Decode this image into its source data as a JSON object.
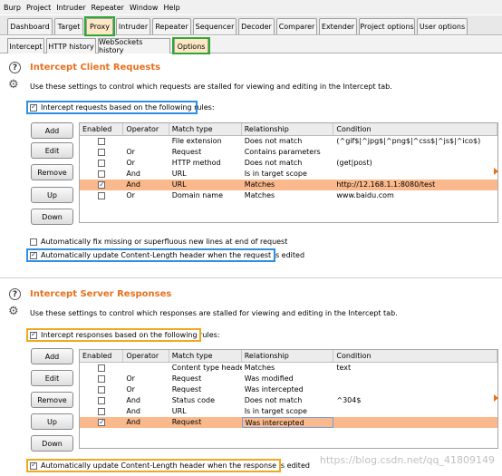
{
  "menu": [
    "Burp",
    "Project",
    "Intruder",
    "Repeater",
    "Window",
    "Help"
  ],
  "main_tabs": [
    "Dashboard",
    "Target",
    "Proxy",
    "Intruder",
    "Repeater",
    "Sequencer",
    "Decoder",
    "Comparer",
    "Extender",
    "Project options",
    "User options"
  ],
  "sub_tabs": [
    "Intercept",
    "HTTP history",
    "WebSockets history",
    "Options"
  ],
  "client": {
    "title": "Intercept Client Requests",
    "description": "Use these settings to control which requests are stalled for viewing and editing in the Intercept tab.",
    "rules_checkbox": "Intercept requests based on the following rules:",
    "buttons": [
      "Add",
      "Edit",
      "Remove",
      "Up",
      "Down"
    ],
    "columns": [
      "Enabled",
      "Operator",
      "Match type",
      "Relationship",
      "Condition"
    ],
    "rows": [
      {
        "enabled": false,
        "operator": "",
        "match_type": "File extension",
        "relationship": "Does not match",
        "condition": "(^gif$|^jpg$|^png$|^css$|^js$|^ico$)"
      },
      {
        "enabled": false,
        "operator": "Or",
        "match_type": "Request",
        "relationship": "Contains parameters",
        "condition": ""
      },
      {
        "enabled": false,
        "operator": "Or",
        "match_type": "HTTP method",
        "relationship": "Does not match",
        "condition": "(get|post)"
      },
      {
        "enabled": false,
        "operator": "And",
        "match_type": "URL",
        "relationship": "Is in target scope",
        "condition": ""
      },
      {
        "enabled": true,
        "operator": "And",
        "match_type": "URL",
        "relationship": "Matches",
        "condition": "http://12.168.1.1:8080/test"
      },
      {
        "enabled": false,
        "operator": "Or",
        "match_type": "Domain name",
        "relationship": "Matches",
        "condition": "www.baidu.com"
      }
    ],
    "fix_newlines": "Automatically fix missing or superfluous new lines at end of request",
    "update_length": "Automatically update Content-Length header when the request is edited"
  },
  "server": {
    "title": "Intercept Server Responses",
    "description": "Use these settings to control which responses are stalled for viewing and editing in the Intercept tab.",
    "rules_checkbox": "Intercept responses based on the following rules:",
    "buttons": [
      "Add",
      "Edit",
      "Remove",
      "Up",
      "Down"
    ],
    "columns": [
      "Enabled",
      "Operator",
      "Match type",
      "Relationship",
      "Condition"
    ],
    "rows": [
      {
        "enabled": false,
        "operator": "",
        "match_type": "Content type header",
        "relationship": "Matches",
        "condition": "text"
      },
      {
        "enabled": false,
        "operator": "Or",
        "match_type": "Request",
        "relationship": "Was modified",
        "condition": ""
      },
      {
        "enabled": false,
        "operator": "Or",
        "match_type": "Request",
        "relationship": "Was intercepted",
        "condition": ""
      },
      {
        "enabled": false,
        "operator": "And",
        "match_type": "Status code",
        "relationship": "Does not match",
        "condition": "^304$"
      },
      {
        "enabled": false,
        "operator": "And",
        "match_type": "URL",
        "relationship": "Is in target scope",
        "condition": ""
      },
      {
        "enabled": true,
        "operator": "And",
        "match_type": "Request",
        "relationship": "Was intercepted",
        "condition": ""
      }
    ],
    "update_length": "Automatically update Content-Length header when the response is edited"
  },
  "watermark": "https://blog.csdn.net/qq_41809149",
  "colors": {
    "accent": "#e8711f",
    "selected_row": "#f9b98c",
    "active_tab": "#fde7c4",
    "highlight_green": "#2fa833",
    "highlight_blue": "#2f8fe0",
    "highlight_orange": "#f0a820"
  }
}
